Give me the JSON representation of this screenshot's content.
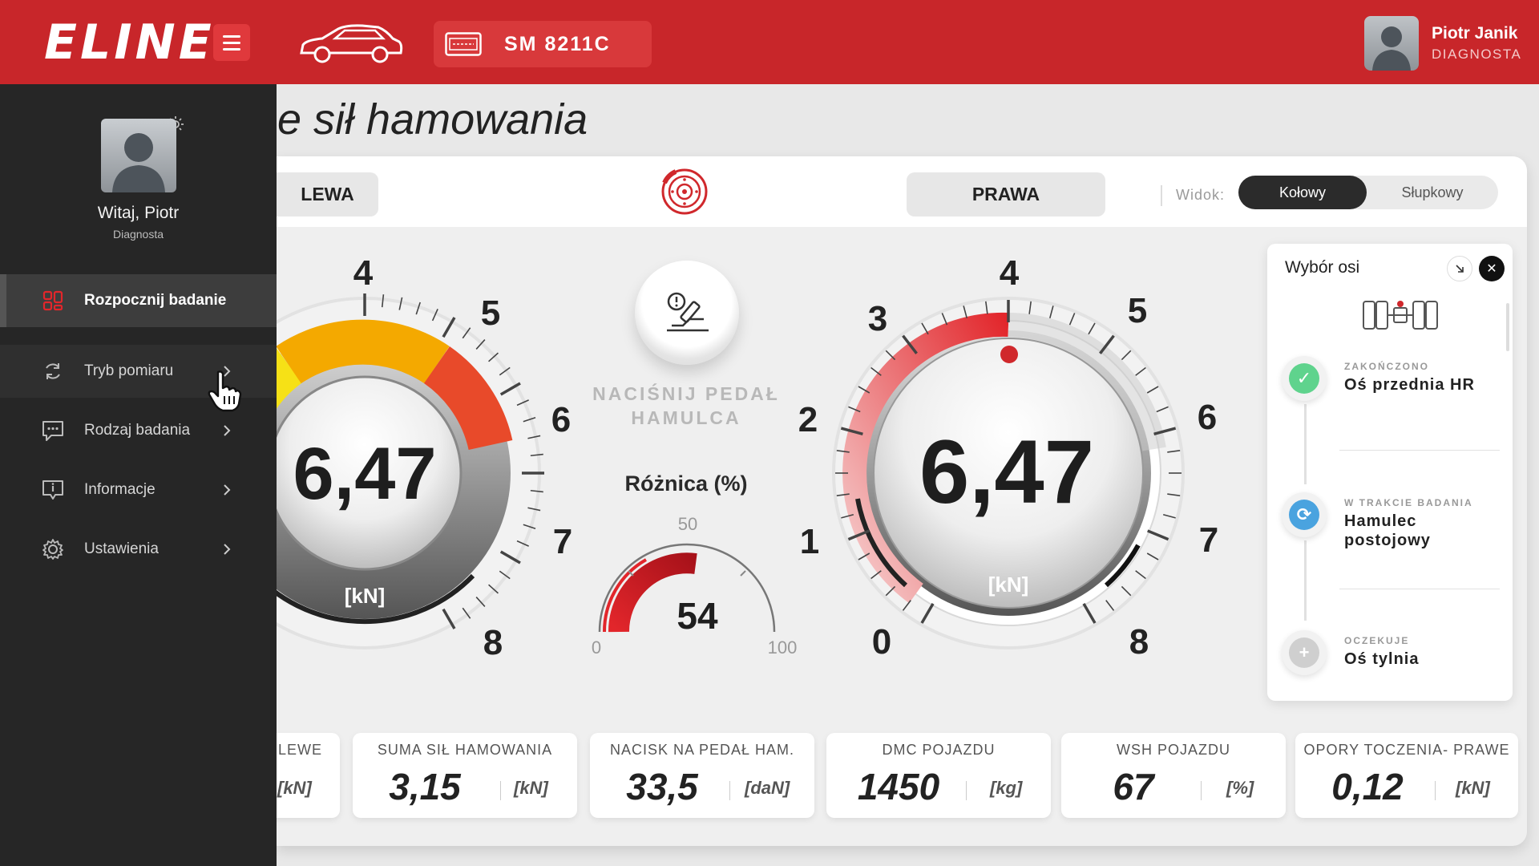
{
  "app": {
    "logo": "ELINE"
  },
  "topbar": {
    "plate": "SM 8211C",
    "user_name": "Piotr Janik",
    "user_role": "DIAGNOSTA"
  },
  "sidebar": {
    "greeting": "Witaj, Piotr",
    "role": "Diagnosta",
    "items": [
      {
        "label": "Rozpocznij badanie",
        "icon": "start-test-icon"
      },
      {
        "label": "Tryb pomiaru",
        "icon": "refresh-mode-icon"
      },
      {
        "label": "Rodzaj badania",
        "icon": "chat-type-icon"
      },
      {
        "label": "Informacje",
        "icon": "info-icon"
      },
      {
        "label": "Ustawienia",
        "icon": "settings-icon"
      }
    ]
  },
  "page": {
    "title": "e sił hamowania"
  },
  "head": {
    "left_label": "LEWA",
    "right_label": "PRAWA",
    "view_label": "Widok:",
    "view_options": [
      "Kołowy",
      "Słupkowy"
    ]
  },
  "gauges": {
    "left": {
      "value": "6,47",
      "unit": "[kN]",
      "ticks": [
        "4",
        "5",
        "6",
        "7",
        "8"
      ]
    },
    "right": {
      "value": "6,47",
      "unit": "[kN]",
      "ticks": [
        "0",
        "1",
        "2",
        "3",
        "4",
        "5",
        "6",
        "7",
        "8"
      ]
    }
  },
  "press": {
    "text_line1": "NACIŚNIJ PEDAŁ",
    "text_line2": "HAMULCA"
  },
  "difference": {
    "title": "Różnica (%)",
    "value": "54",
    "min": "0",
    "mid": "50",
    "max": "100"
  },
  "axis_panel": {
    "title": "Wybór osi",
    "steps": [
      {
        "status": "ZAKOŃCZONO",
        "name": "Oś przednia HR",
        "state": "done",
        "color": "#5fd38d"
      },
      {
        "status": "W TRAKCIE BADANIA",
        "name": "Hamulec postojowy",
        "state": "progress",
        "color": "#4aa3df"
      },
      {
        "status": "OCZEKUJE",
        "name": "Oś tylnia",
        "state": "waiting",
        "color": "#cfcfcf"
      }
    ]
  },
  "stats": [
    {
      "label": "LEWE",
      "value": "",
      "unit": "[kN]"
    },
    {
      "label": "SUMA SIŁ HAMOWANIA",
      "value": "3,15",
      "unit": "[kN]"
    },
    {
      "label": "NACISK NA PEDAŁ HAM.",
      "value": "33,5",
      "unit": "[daN]"
    },
    {
      "label": "DMC POJAZDU",
      "value": "1450",
      "unit": "[kg]"
    },
    {
      "label": "WSH POJAZDU",
      "value": "67",
      "unit": "[%]"
    },
    {
      "label": "OPORY TOCZENIA- PRAWE",
      "value": "0,12",
      "unit": "[kN]"
    }
  ],
  "colors": {
    "brand": "#c8262a",
    "sidebar": "#262626",
    "accent_red": "#e53935"
  }
}
